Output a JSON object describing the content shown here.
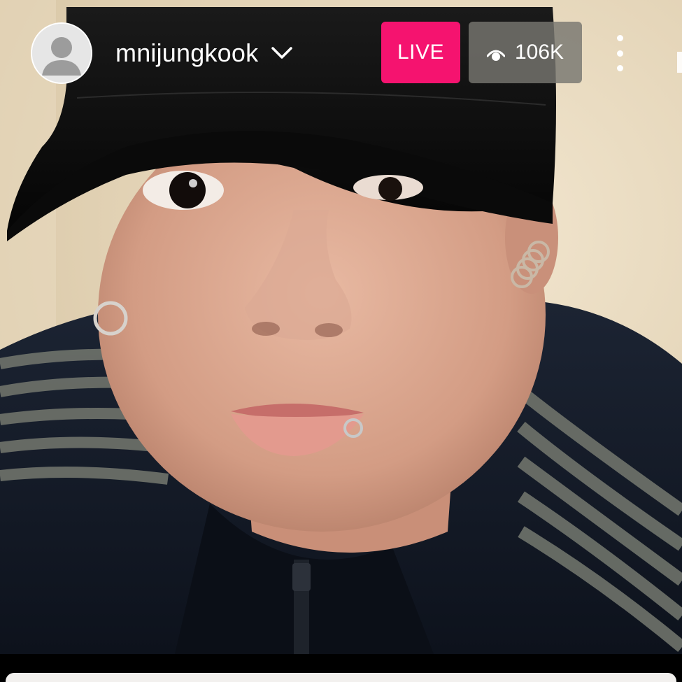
{
  "stream": {
    "username": "mnijungkook",
    "live_label": "LIVE",
    "viewer_count": "106K"
  },
  "colors": {
    "live_badge": "#f5136f",
    "viewer_pill": "#78766f",
    "text": "#ffffff"
  },
  "icons": {
    "avatar": "default-user-avatar",
    "dropdown": "chevron-down-icon",
    "viewers": "eye-icon",
    "menu": "more-vertical-icon"
  }
}
